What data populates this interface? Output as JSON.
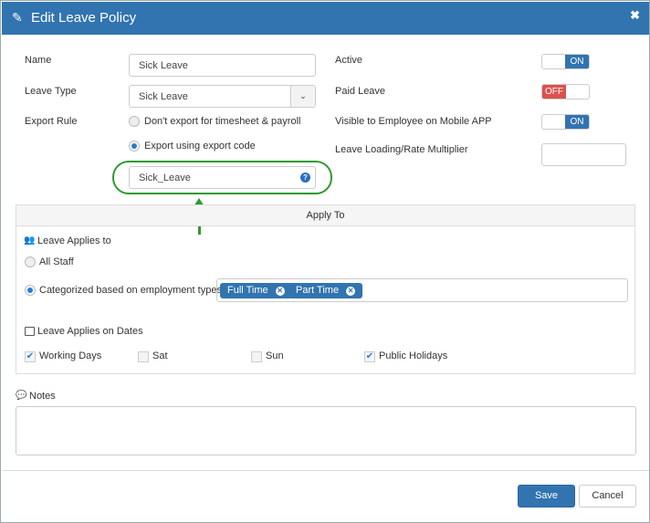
{
  "dialog": {
    "title": "Edit Leave Policy",
    "title_icon": "edit-icon",
    "close_icon": "close-icon"
  },
  "form": {
    "name_label": "Name",
    "name_value": "Sick Leave",
    "leave_type_label": "Leave Type",
    "leave_type_value": "Sick Leave",
    "export_rule_label": "Export Rule",
    "export_options": [
      "Don't export for timesheet & payroll",
      "Export using export code"
    ],
    "export_selected": 1,
    "export_code_value": "Sick_Leave",
    "active_label": "Active",
    "active_state": "ON",
    "paid_label": "Paid Leave",
    "paid_state": "OFF",
    "visible_label": "Visible to Employee on Mobile APP",
    "visible_state": "ON",
    "multiplier_label": "Leave Loading/Rate Multiplier",
    "multiplier_value": ""
  },
  "apply_to": {
    "header": "Apply To",
    "applies_to_label": "Leave Applies to",
    "all_staff": "All Staff",
    "categorized": "Categorized based on employment types",
    "chips": [
      "Full Time",
      "Part Time"
    ],
    "dates_label": "Leave Applies on Dates",
    "days": [
      {
        "label": "Working Days",
        "checked": true
      },
      {
        "label": "Sat",
        "checked": false
      },
      {
        "label": "Sun",
        "checked": false
      },
      {
        "label": "Public Holidays",
        "checked": true
      }
    ]
  },
  "notes": {
    "label": "Notes",
    "value": ""
  },
  "footer": {
    "save": "Save",
    "cancel": "Cancel"
  },
  "colors": {
    "primary": "#3174b0",
    "danger": "#d9534f",
    "highlight": "#2e9a2e"
  }
}
